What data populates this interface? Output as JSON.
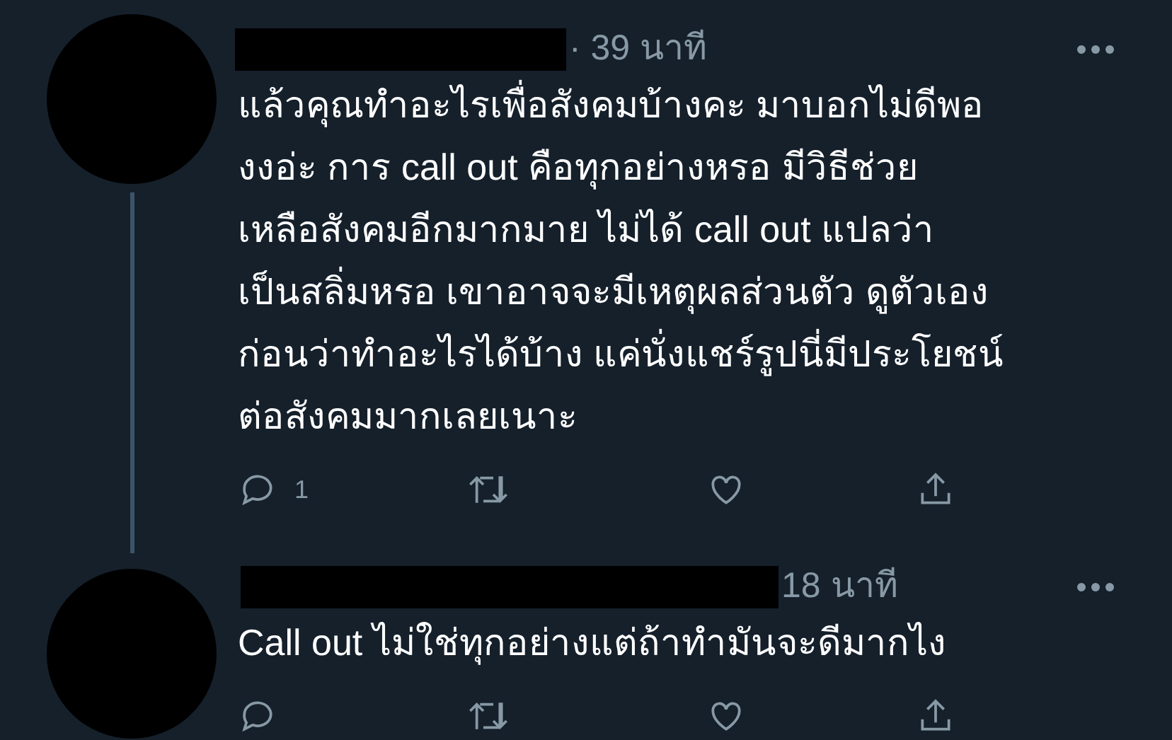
{
  "tweets": [
    {
      "time": "· 39 นาที",
      "text": "แล้วคุณทำอะไรเพื่อสังคมบ้างคะ มาบอกไม่ดีพอ\nงงอ่ะ การ call out คือทุกอย่างหรอ มีวิธีช่วย\nเหลือสังคมอีกมากมาย ไม่ได้ call out แปลว่า\nเป็นสลิ่มหรอ เขาอาจจะมีเหตุผลส่วนตัว ดูตัวเอง\nก่อนว่าทำอะไรได้บ้าง แค่นั่งแชร์รูปนี่มีประโยชน์\nต่อสังคมมากเลยเนาะ",
      "reply_count": "1",
      "thread_line": true
    },
    {
      "time": "18 นาที",
      "text": "Call out ไม่ใช่ทุกอย่างแต่ถ้าทำมันจะดีมากไง"
    }
  ]
}
